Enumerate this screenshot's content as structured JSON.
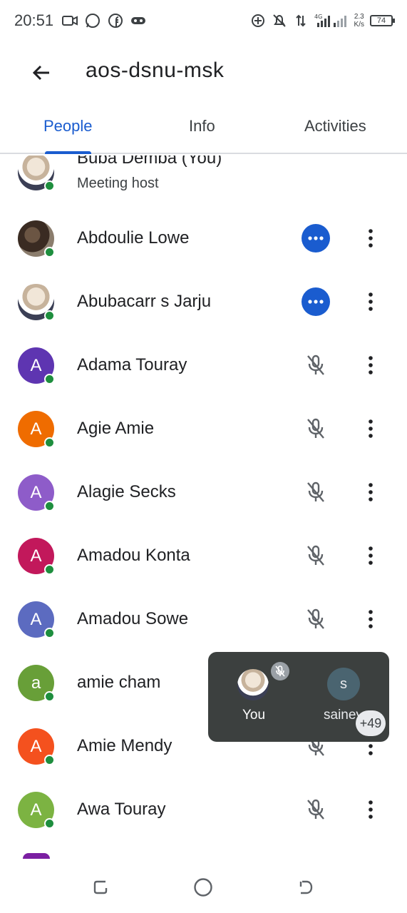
{
  "status_bar": {
    "time": "20:51",
    "net_speed_value": "2.3",
    "net_speed_unit": "K/s",
    "network_type": "4G",
    "battery": "74"
  },
  "header": {
    "title": "aos-dsnu-msk"
  },
  "tabs": [
    {
      "label": "People",
      "active": true
    },
    {
      "label": "Info",
      "active": false
    },
    {
      "label": "Activities",
      "active": false
    }
  ],
  "people": [
    {
      "name": "Buba Demba (You)",
      "subtitle": "Meeting host",
      "avatar_type": "photo",
      "status": "none"
    },
    {
      "name": "Abdoulie Lowe",
      "avatar_type": "photo",
      "status": "speaking"
    },
    {
      "name": "Abubacarr s Jarju",
      "avatar_type": "photo",
      "status": "speaking"
    },
    {
      "name": "Adama Touray",
      "initial": "A",
      "avatar_color": "#5e35b1",
      "status": "muted"
    },
    {
      "name": "Agie Amie",
      "initial": "A",
      "avatar_color": "#ef6c00",
      "status": "muted"
    },
    {
      "name": "Alagie Secks",
      "initial": "A",
      "avatar_color": "#8e5cc9",
      "status": "muted"
    },
    {
      "name": "Amadou Konta",
      "initial": "A",
      "avatar_color": "#c2185b",
      "status": "muted"
    },
    {
      "name": "Amadou Sowe",
      "initial": "A",
      "avatar_color": "#5c6bc0",
      "status": "muted"
    },
    {
      "name": "amie cham",
      "initial": "a",
      "avatar_color": "#689f38",
      "status": "muted"
    },
    {
      "name": "Amie Mendy",
      "initial": "A",
      "avatar_color": "#f4511e",
      "status": "muted"
    },
    {
      "name": "Awa Touray",
      "initial": "A",
      "avatar_color": "#7cb342",
      "status": "muted"
    }
  ],
  "pip": {
    "self_label": "You",
    "other_initial": "s",
    "other_label": "sainey",
    "more_count": "+49"
  },
  "colors": {
    "accent": "#1a5ccf",
    "online": "#1e8e3e",
    "pip_bg": "#3c403f"
  }
}
